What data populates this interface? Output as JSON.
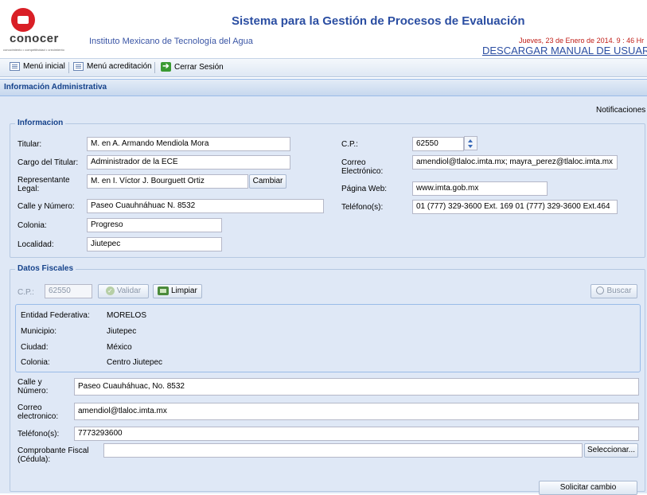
{
  "header": {
    "logo_text": "conocer",
    "logo_tagline": "conocimiento • competitividad • crecimiento",
    "institution": "Instituto Mexicano de Tecnología del Agua",
    "app_title": "Sistema para la Gestión de Procesos de Evaluación",
    "date": "Jueves, 23 de Enero de 2014. 9 : 46 Hr",
    "manual_link": "DESCARGAR MANUAL DE USUARIO"
  },
  "toolbar": {
    "menu_inicial": "Menú inicial",
    "menu_acreditacion": "Menú acreditación",
    "cerrar_sesion": "Cerrar Sesión"
  },
  "panel": {
    "title": "Información Administrativa",
    "notifications": "Notificaciones"
  },
  "informacion": {
    "legend": "Informacion",
    "titular_label": "Titular:",
    "titular_value": "M. en A. Armando Mendiola Mora",
    "cargo_label": "Cargo del Titular:",
    "cargo_value": "Administrador de la ECE",
    "representante_label": "Representante Legal:",
    "representante_value": "M. en I. Víctor J. Bourguett Ortiz",
    "cambiar_button": "Cambiar",
    "calle_label": "Calle y Número:",
    "calle_value": "Paseo Cuauhnáhuac N. 8532",
    "colonia_label": "Colonia:",
    "colonia_value": "Progreso",
    "localidad_label": "Localidad:",
    "localidad_value": "Jiutepec",
    "cp_label": "C.P.:",
    "cp_value": "62550",
    "correo_label": "Correo Electrónico:",
    "correo_value": "amendiol@tlaloc.imta.mx; mayra_perez@tlaloc.imta.mx",
    "web_label": "Página Web:",
    "web_value": "www.imta.gob.mx",
    "telefono_label": "Teléfono(s):",
    "telefono_value": "01 (777) 329-3600 Ext. 169  01 (777) 329-3600 Ext.464"
  },
  "fiscales": {
    "legend": "Datos Fiscales",
    "cp_label": "C.P.:",
    "cp_value": "62550",
    "validar_button": "Validar",
    "limpiar_button": "Limpiar",
    "buscar_button": "Buscar",
    "entidad_label": "Entidad Federativa:",
    "entidad_value": "MORELOS",
    "municipio_label": "Municipio:",
    "municipio_value": "Jiutepec",
    "ciudad_label": "Ciudad:",
    "ciudad_value": "México",
    "colonia_label": "Colonia:",
    "colonia_value": "Centro Jiutepec",
    "calle_label": "Calle y Número:",
    "calle_value": "Paseo Cuauháhuac, No. 8532",
    "correo_label": "Correo electronico:",
    "correo_value": "amendiol@tlaloc.imta.mx",
    "telefono_label": "Teléfono(s):",
    "telefono_value": "7773293600",
    "comprobante_label": "Comprobante Fiscal (Cédula):",
    "comprobante_value": "",
    "seleccionar_button": "Seleccionar...",
    "solicitar_button": "Solicitar cambio"
  }
}
